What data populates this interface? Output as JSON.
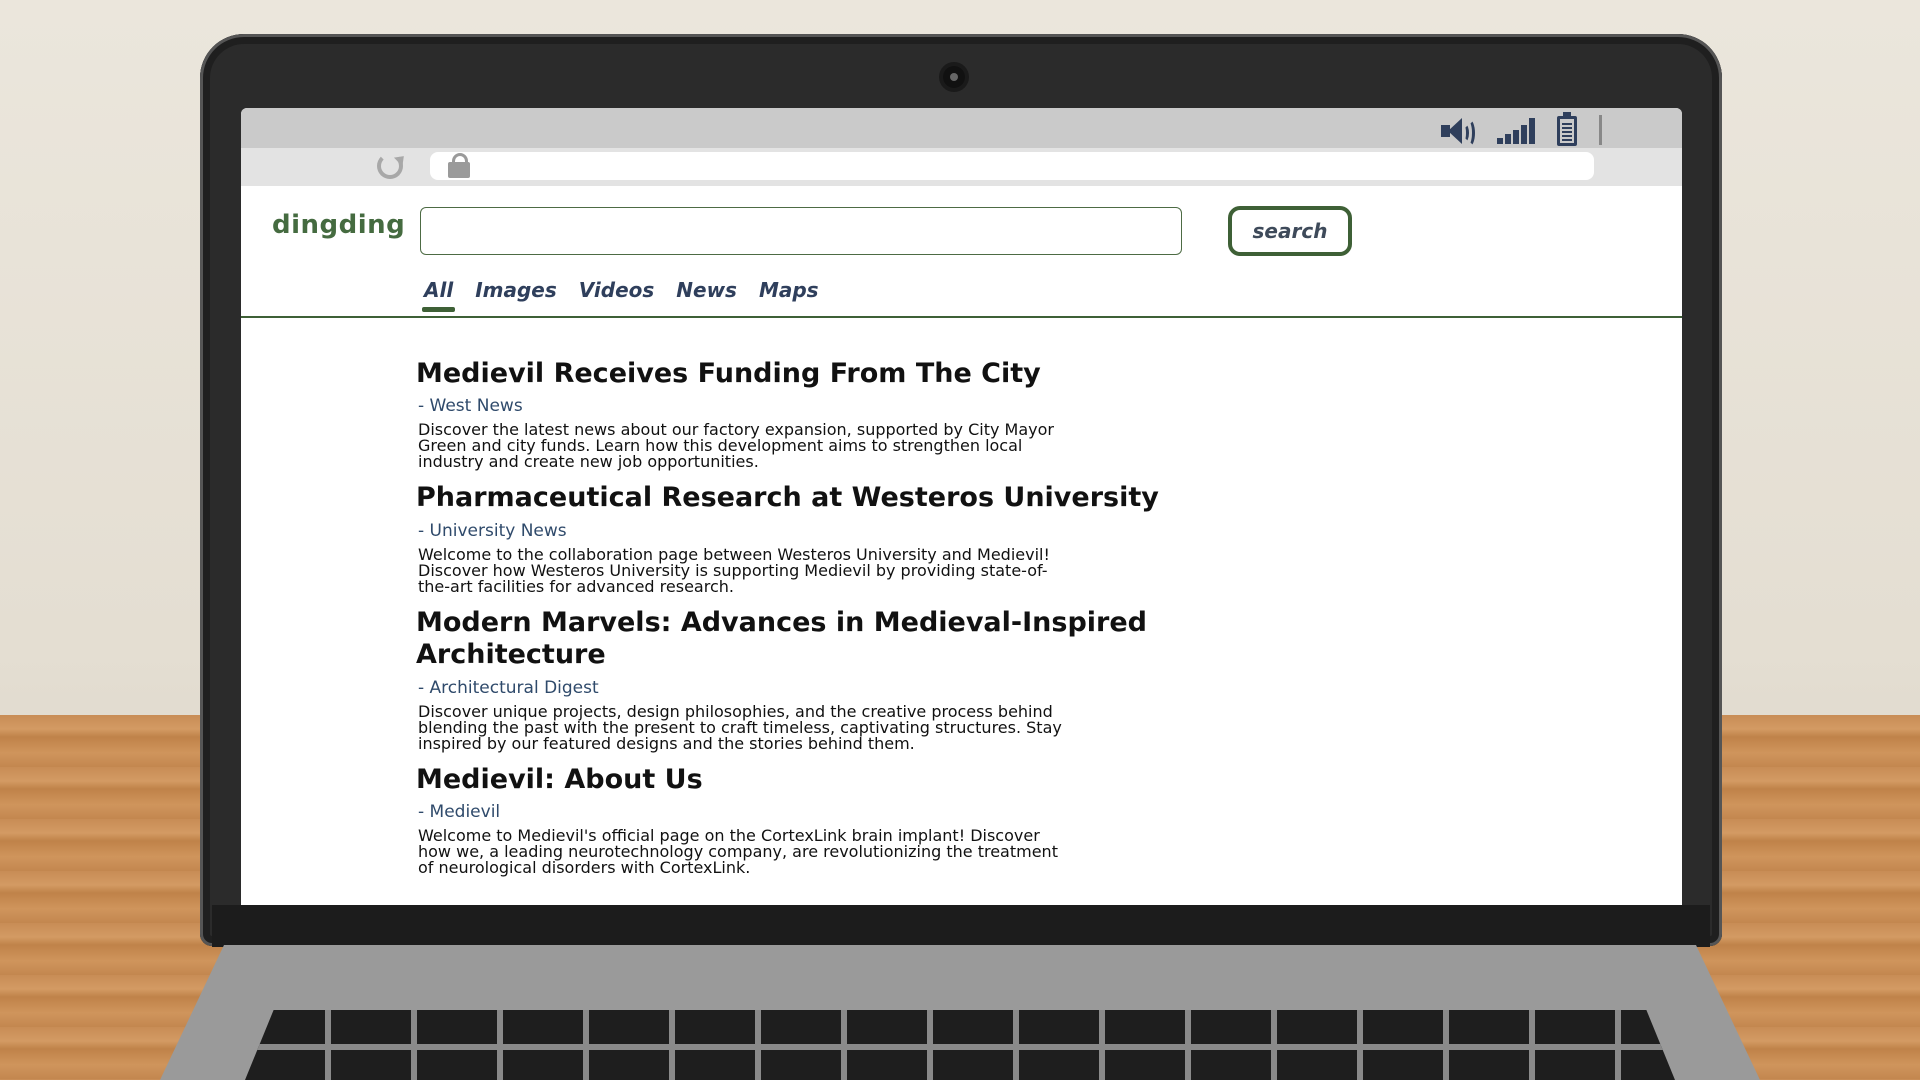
{
  "browser": {
    "url": "",
    "status_icons": [
      "speaker-icon",
      "signal-icon",
      "battery-icon"
    ]
  },
  "search": {
    "logo": "dingding",
    "query": "",
    "placeholder": "",
    "button_label": "search"
  },
  "tabs": [
    {
      "label": "All",
      "active": true
    },
    {
      "label": "Images",
      "active": false
    },
    {
      "label": "Videos",
      "active": false
    },
    {
      "label": "News",
      "active": false
    },
    {
      "label": "Maps",
      "active": false
    }
  ],
  "results": [
    {
      "title": "Medievil Receives Funding From The City",
      "source": "- West News",
      "snippet": "Discover the latest news about our factory expansion, supported by City Mayor Green and city funds. Learn how this development aims to strengthen local industry and create new job opportunities."
    },
    {
      "title": "Pharmaceutical Research at Westeros University",
      "source": "- University News",
      "snippet": "Welcome to the collaboration page between Westeros University and Medievil! Discover how Westeros University is supporting Medievil by providing state-of-the-art facilities for advanced research."
    },
    {
      "title": "Modern Marvels: Advances in Medieval-Inspired Architecture",
      "source": "- Architectural Digest",
      "snippet": "Discover unique projects, design philosophies, and the creative process behind blending the past with the present to craft timeless, captivating structures. Stay inspired by our featured designs and the stories behind them."
    },
    {
      "title": "Medievil: About Us",
      "source": "- Medievil",
      "snippet": "Welcome to Medievil's official page on the CortexLink brain implant! Discover how we, a leading neurotechnology company, are revolutionizing the treatment of neurological disorders with CortexLink."
    }
  ],
  "colors": {
    "accent": "#3e6036",
    "logo": "#456b40",
    "source_text": "#2f4a6b",
    "tab_text": "#2f3f5c"
  }
}
